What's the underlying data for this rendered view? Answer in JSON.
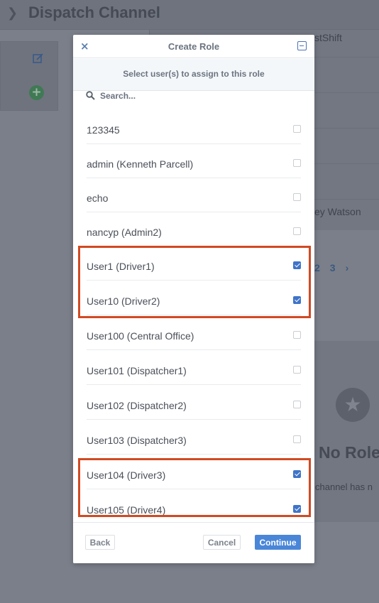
{
  "background": {
    "title": "Dispatch Channel",
    "chevron_icon": "chevron-right-icon",
    "top_right_text": "stShift",
    "row_text": "ey Watson",
    "pager": [
      "2",
      "3",
      "›"
    ],
    "empty_title": "No Role",
    "empty_text": "channel has n"
  },
  "modal": {
    "title": "Create Role",
    "close_label": "×",
    "subtitle": "Select user(s) to assign to this role",
    "search": {
      "placeholder": "Search...",
      "value": ""
    },
    "users": [
      {
        "label": "123345",
        "checked": false
      },
      {
        "label": "admin (Kenneth Parcell)",
        "checked": false
      },
      {
        "label": "echo",
        "checked": false
      },
      {
        "label": "nancyp (Admin2)",
        "checked": false
      },
      {
        "label": "User1 (Driver1)",
        "checked": true
      },
      {
        "label": "User10 (Driver2)",
        "checked": true
      },
      {
        "label": "User100 (Central Office)",
        "checked": false
      },
      {
        "label": "User101 (Dispatcher1)",
        "checked": false
      },
      {
        "label": "User102 (Dispatcher2)",
        "checked": false
      },
      {
        "label": "User103 (Dispatcher3)",
        "checked": false
      },
      {
        "label": "User104 (Driver3)",
        "checked": true
      },
      {
        "label": "User105 (Driver4)",
        "checked": true
      }
    ],
    "buttons": {
      "back": "Back",
      "cancel": "Cancel",
      "continue": "Continue"
    }
  },
  "colors": {
    "accent": "#4a86d8",
    "checkbox_checked": "#3f74c9",
    "highlight": "#d14a23",
    "overlay": "#7b7f8a"
  }
}
